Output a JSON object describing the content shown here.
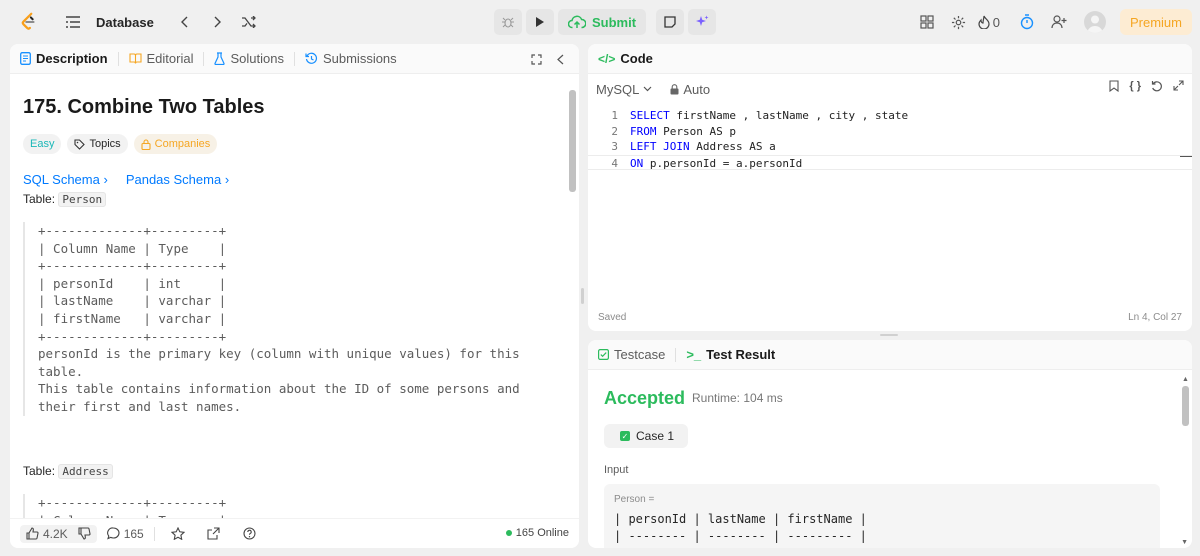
{
  "nav": {
    "title": "Database",
    "submit_label": "Submit",
    "streak_count": "0",
    "premium_label": "Premium"
  },
  "left_tabs": [
    {
      "label": "Description"
    },
    {
      "label": "Editorial"
    },
    {
      "label": "Solutions"
    },
    {
      "label": "Submissions"
    }
  ],
  "problem": {
    "title": "175. Combine Two Tables",
    "chips": {
      "difficulty": "Easy",
      "topics": "Topics",
      "companies": "Companies"
    },
    "links": {
      "sql": "SQL Schema",
      "pandas": "Pandas Schema"
    },
    "table_prefix": "Table: ",
    "person_table_name": "Person",
    "address_table_name": "Address",
    "person_schema": "+-------------+---------+\n| Column Name | Type    |\n+-------------+---------+\n| personId    | int     |\n| lastName    | varchar |\n| firstName   | varchar |\n+-------------+---------+\npersonId is the primary key (column with unique values) for this\ntable.\nThis table contains information about the ID of some persons and\ntheir first and last names.",
    "address_schema_peek": "+-------------+---------+\n| Column Name | Type    |"
  },
  "footer": {
    "likes": "4.2K",
    "comments": "165",
    "online": "165 Online"
  },
  "code_panel": {
    "title": "Code",
    "language": "MySQL",
    "mode": "Auto",
    "lines": [
      {
        "n": "1",
        "kw": "SELECT",
        "rest": " firstName , lastName , city , state"
      },
      {
        "n": "2",
        "kw": "FROM",
        "rest": " Person AS p"
      },
      {
        "n": "3",
        "kw": "LEFT JOIN",
        "rest": " Address AS a"
      },
      {
        "n": "4",
        "kw": "ON",
        "rest": " p.personId = a.personId"
      }
    ],
    "saved": "Saved",
    "cursor": "Ln 4, Col 27"
  },
  "result": {
    "tabs": {
      "testcase": "Testcase",
      "test_result": "Test Result"
    },
    "status": "Accepted",
    "runtime": "Runtime: 104 ms",
    "case": "Case 1",
    "input_label": "Input",
    "var_label": "Person =",
    "row_header": "| personId | lastName | firstName |",
    "row_divider": "| -------- | -------- | --------- |"
  }
}
